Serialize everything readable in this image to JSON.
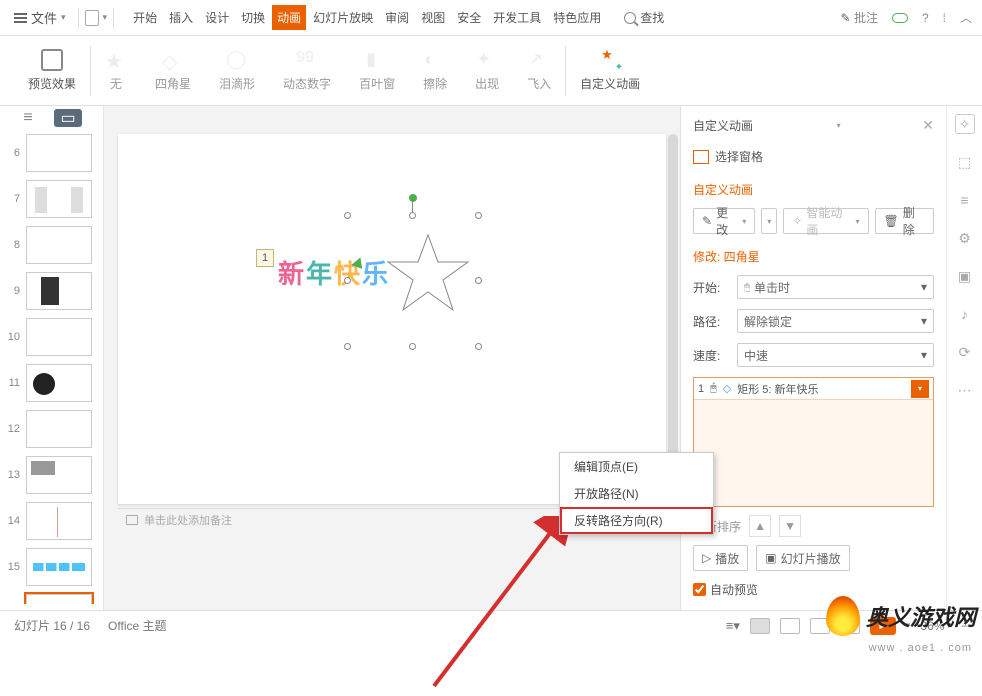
{
  "topbar": {
    "file": "文件",
    "tabs": [
      "开始",
      "插入",
      "设计",
      "切换",
      "动画",
      "幻灯片放映",
      "审阅",
      "视图",
      "安全",
      "开发工具",
      "特色应用"
    ],
    "active_tab_index": 4,
    "search": "查找",
    "annotate": "批注"
  },
  "ribbon": {
    "preview": "预览效果",
    "effects": [
      "无",
      "四角星",
      "泪滴形",
      "动态数字",
      "百叶窗",
      "擦除",
      "出现",
      "飞入"
    ],
    "custom": "自定义动画"
  },
  "thumbnails": {
    "start": 6,
    "count": 11,
    "active": 16
  },
  "canvas": {
    "text": "新年快乐",
    "seq": "1",
    "notes_placeholder": "单击此处添加备注"
  },
  "context_menu": {
    "items": [
      "编辑顶点(E)",
      "开放路径(N)",
      "反转路径方向(R)"
    ],
    "highlighted_index": 2
  },
  "panel": {
    "title": "自定义动画",
    "select_pane": "选择窗格",
    "section": "自定义动画",
    "change": "更改",
    "smart": "智能动画",
    "delete": "删除",
    "modify_header": "修改: 四角星",
    "start_label": "开始:",
    "start_value": "单击时",
    "path_label": "路径:",
    "path_value": "解除锁定",
    "speed_label": "速度:",
    "speed_value": "中速",
    "effect_seq": "1",
    "effect_name": "矩形 5: 新年快乐",
    "reorder": "重新排序",
    "play": "播放",
    "slideshow": "幻灯片播放",
    "auto_preview": "自动预览"
  },
  "status": {
    "slide": "幻灯片 16 / 16",
    "theme": "Office 主题",
    "zoom": "36%"
  },
  "watermark": {
    "text": "奥义游戏网",
    "url": "www . aoe1 . com"
  }
}
